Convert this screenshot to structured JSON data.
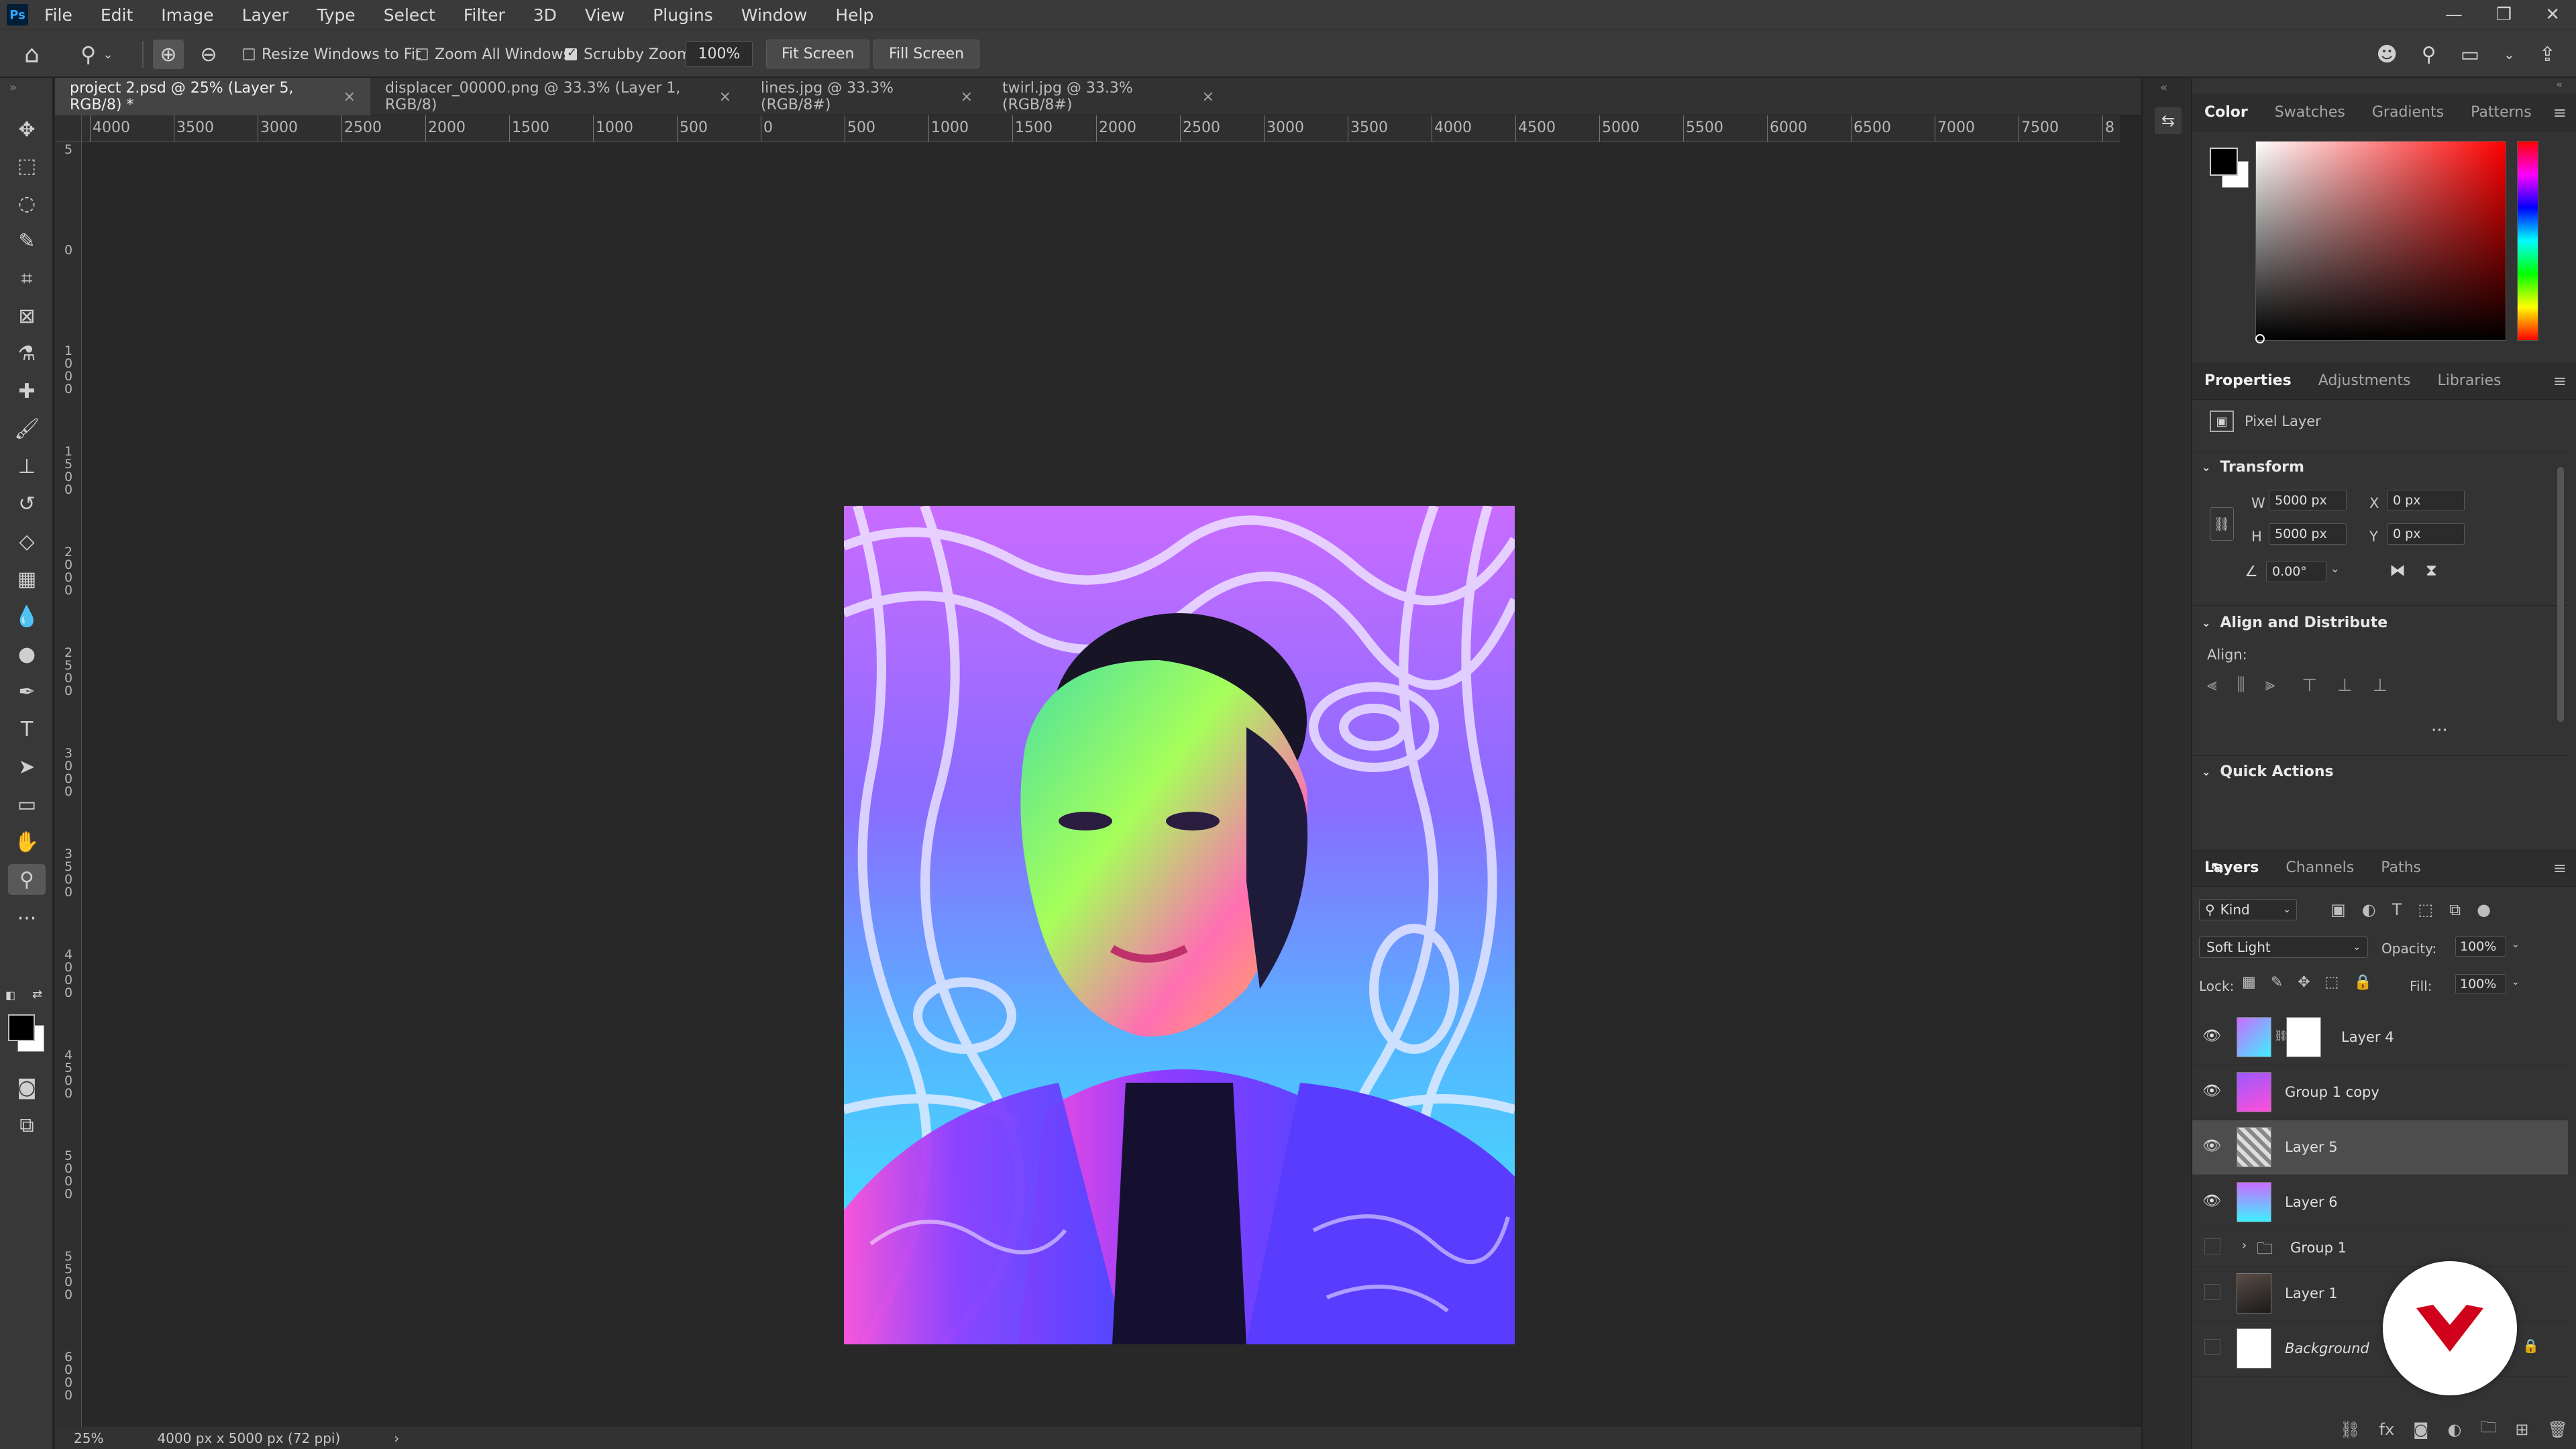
{
  "app": {
    "logo": "Ps"
  },
  "menu": [
    "File",
    "Edit",
    "Image",
    "Layer",
    "Type",
    "Select",
    "Filter",
    "3D",
    "View",
    "Plugins",
    "Window",
    "Help"
  ],
  "options": {
    "resize_windows": "Resize Windows to Fit",
    "zoom_all": "Zoom All Windows",
    "scrubby": "Scrubby Zoom",
    "zoom_value": "100%",
    "fit_screen": "Fit Screen",
    "fill_screen": "Fill Screen"
  },
  "tabs": [
    {
      "label": "project 2.psd @ 25% (Layer 5, RGB/8) *",
      "active": true
    },
    {
      "label": "displacer_00000.png @ 33.3% (Layer 1, RGB/8)",
      "active": false
    },
    {
      "label": "lines.jpg @ 33.3% (RGB/8#)",
      "active": false
    },
    {
      "label": "twirl.jpg @ 33.3% (RGB/8#)",
      "active": false
    }
  ],
  "ruler_top": [
    "4000",
    "3500",
    "3000",
    "2500",
    "2000",
    "1500",
    "1000",
    "500",
    "0",
    "500",
    "1000",
    "1500",
    "2000",
    "2500",
    "3000",
    "3500",
    "4000",
    "4500",
    "5000",
    "5500",
    "6000",
    "6500",
    "7000",
    "7500",
    "8"
  ],
  "ruler_left": [
    "5",
    "0",
    "1000",
    "1500",
    "2000",
    "2500",
    "3000",
    "3500",
    "4000",
    "4500",
    "5000",
    "5500",
    "6000"
  ],
  "status": {
    "zoom": "25%",
    "doc_size": "4000 px x 5000 px (72 ppi)",
    "arrow": "›"
  },
  "color_panel": {
    "tabs": [
      "Color",
      "Swatches",
      "Gradients",
      "Patterns"
    ],
    "foreground": "#000000",
    "background": "#ffffff"
  },
  "properties": {
    "tabs": [
      "Properties",
      "Adjustments",
      "Libraries"
    ],
    "kind": "Pixel Layer",
    "transform_title": "Transform",
    "w_label": "W",
    "w_value": "5000 px",
    "h_label": "H",
    "h_value": "5000 px",
    "x_label": "X",
    "x_value": "0 px",
    "y_label": "Y",
    "y_value": "0 px",
    "angle_value": "0.00°",
    "align_title": "Align and Distribute",
    "align_label": "Align:",
    "quick_actions": "Quick Actions"
  },
  "layers_panel": {
    "tabs": [
      "Layers",
      "Channels",
      "Paths"
    ],
    "filter_kind": "Kind",
    "blend_mode": "Soft Light",
    "opacity_label": "Opacity:",
    "opacity_value": "100%",
    "lock_label": "Lock:",
    "fill_label": "Fill:",
    "fill_value": "100%",
    "layers": [
      {
        "name": "Layer 4",
        "visible": true,
        "selected": false
      },
      {
        "name": "Group 1 copy",
        "visible": true,
        "selected": false
      },
      {
        "name": "Layer 5",
        "visible": true,
        "selected": true
      },
      {
        "name": "Layer 6",
        "visible": true,
        "selected": false
      },
      {
        "name": "Group 1",
        "visible": false,
        "selected": false
      },
      {
        "name": "Layer 1",
        "visible": false,
        "selected": false
      },
      {
        "name": "Background",
        "visible": false,
        "selected": false
      }
    ]
  },
  "colors": {
    "accent": "#31a8ff",
    "selected_layer": "#4d4d4d",
    "watermark": "#d0021b"
  }
}
